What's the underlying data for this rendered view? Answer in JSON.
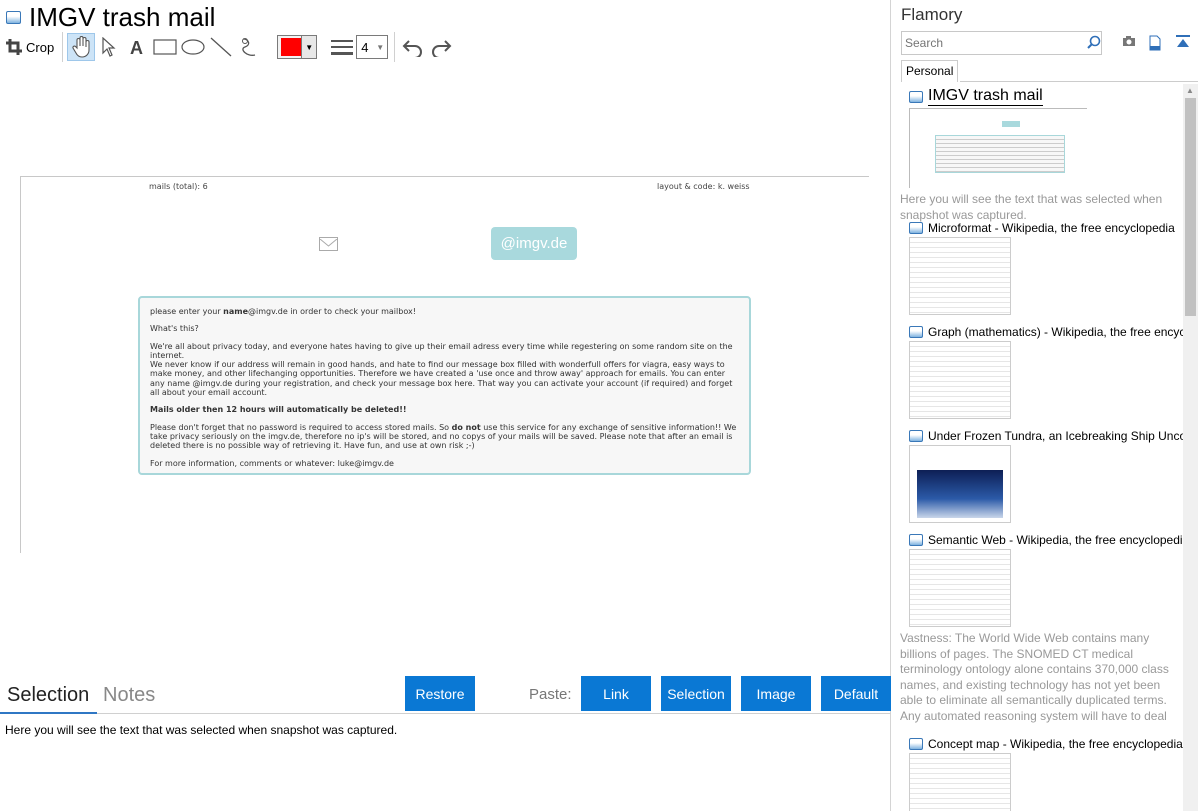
{
  "window": {
    "title": "IMGV trash mail"
  },
  "toolbar": {
    "crop_label": "Crop",
    "tools": [
      "hand-icon",
      "pointer-icon",
      "text-icon",
      "rectangle-icon",
      "ellipse-icon",
      "line-icon",
      "freehand-icon"
    ],
    "color": "#ff0000",
    "line_width": "4"
  },
  "snapshot": {
    "mails_total": "mails (total): 6",
    "credit": "layout & code: k. weiss",
    "badge": "@imgv.de",
    "intro_pre": "please enter your ",
    "intro_bold": "name",
    "intro_post": "@imgv.de in order to check your mailbox!",
    "whats_this": "What's this?",
    "para1": "We're all about privacy today, and everyone hates having to give up their email adress every time while regestering on some random site on the internet.",
    "para2": "We never know if our address will remain in good hands, and hate to find our message box filled with wonderfull offers for viagra, easy ways to make money, and other lifechanging opportunities. Therefore we have created a 'use once and throw away' approach for emails. You can enter any name @imgv.de during your registration, and check your message box here. That way you can activate your account (if required) and forget all about your email account.",
    "warning": "Mails older then 12 hours will automatically be deleted!!",
    "para3_pre": "Please don't forget that no password is required to access stored mails. So ",
    "para3_bold": "do not",
    "para3_post": " use this service for any exchange of sensitive information!! We take privacy seriously on the imgv.de, therefore no ip's will be stored, and no copys of your mails will be saved. Please note that after an email is deleted there is no possible way of retrieving it. Have fun, and use at own risk ;-)",
    "contact": "For more information, comments or whatever: luke@imgv.de"
  },
  "bottom": {
    "tab_selection": "Selection",
    "tab_notes": "Notes",
    "restore": "Restore",
    "paste_label": "Paste:",
    "paste_link": "Link",
    "paste_selection": "Selection",
    "paste_image": "Image",
    "paste_default": "Default",
    "selection_text": "Here you will see the text that was selected when snapshot was captured."
  },
  "sidebar": {
    "title": "Flamory",
    "search_placeholder": "Search",
    "tab_personal": "Personal",
    "items": [
      {
        "title": "IMGV trash mail",
        "desc": "Here you will see the text that was selected when snapshot was captured."
      },
      {
        "title": "Microformat - Wikipedia, the free encyclopedia"
      },
      {
        "title": "Graph (mathematics) - Wikipedia, the free encyclopedia"
      },
      {
        "title": "Under Frozen Tundra, an Icebreaking Ship Uncovers"
      },
      {
        "title": "Semantic Web - Wikipedia, the free encyclopedia",
        "desc": "Vastness: The World Wide Web contains many billions of pages. The SNOMED CT medical terminology ontology alone contains 370,000 class names, and existing technology has not yet been able to eliminate all semantically duplicated terms. Any automated reasoning system will have to deal with truly huge inputs."
      },
      {
        "title": "Concept map - Wikipedia, the free encyclopedia"
      }
    ]
  }
}
